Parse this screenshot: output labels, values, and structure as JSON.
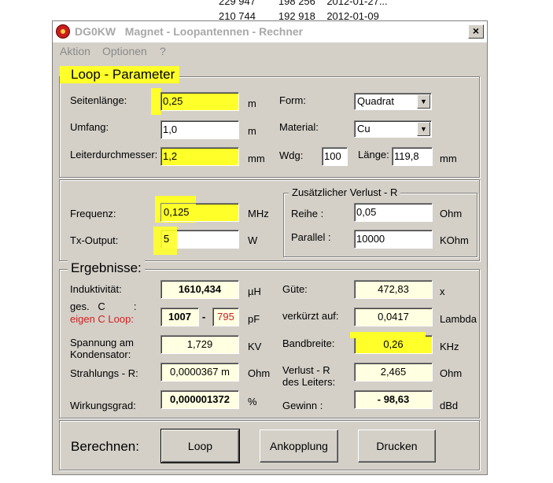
{
  "background": {
    "row1": "229 947        198 256    2012-01-27...",
    "row2": "210 744        192 918    2012-01-09"
  },
  "window": {
    "title": "DG0KW   Magnet - Loopantennen - Rechner",
    "close_label": "×"
  },
  "menu": [
    "Aktion",
    "Optionen",
    "?"
  ],
  "loop_parameter": {
    "legend": "Loop - Parameter",
    "seitenlaenge": {
      "label": "Seitenlänge:",
      "value": "0,25",
      "unit": "m"
    },
    "umfang": {
      "label": "Umfang:",
      "value": "1,0",
      "unit": "m"
    },
    "leiterdurchmesser": {
      "label": "Leiterdurchmesser:",
      "value": "1,2",
      "unit": "mm"
    },
    "form": {
      "label": "Form:",
      "value": "Quadrat"
    },
    "material": {
      "label": "Material:",
      "value": "Cu"
    },
    "wdg": {
      "label": "Wdg:",
      "value": "100"
    },
    "laenge": {
      "label": "Länge:",
      "value": "119,8",
      "unit": "mm"
    }
  },
  "frequency": {
    "frequenz": {
      "label": "Frequenz:",
      "value": "0,125",
      "unit": "MHz"
    },
    "tx_output": {
      "label": "Tx-Output:",
      "value": "5",
      "unit": "W"
    }
  },
  "verlust": {
    "legend": "Zusätzlicher Verlust - R",
    "reihe": {
      "label": "Reihe :",
      "value": "0,05",
      "unit": "Ohm"
    },
    "parallel": {
      "label": "Parallel :",
      "value": "10000",
      "unit": "KOhm"
    }
  },
  "ergebnisse": {
    "legend": "Ergebnisse:",
    "induktivitaet": {
      "label": "Induktivität:",
      "value": "1610,434",
      "unit": "µH"
    },
    "ges_c": {
      "label": "ges.   C          :",
      "label2": "eigen C Loop:",
      "value": "1007",
      "dash": "-",
      "value2": "795",
      "unit": "pF"
    },
    "spannung": {
      "label": "Spannung am",
      "label2": "Kondensator:",
      "value": "1,729",
      "unit": "KV"
    },
    "strahlung": {
      "label": "Strahlungs - R:",
      "value": "0,0000367 m",
      "unit": "Ohm"
    },
    "wirkungsgrad": {
      "label": "Wirkungsgrad:",
      "value": "0,000001372",
      "unit": "%"
    },
    "guete": {
      "label": "Güte:",
      "value": "472,83",
      "unit": "x"
    },
    "verkuerzt": {
      "label": "verkürzt auf:",
      "value": "0,0417",
      "unit": "Lambda"
    },
    "bandbreite": {
      "label": "Bandbreite:",
      "value": "0,26",
      "unit": "KHz"
    },
    "verlust_r": {
      "label": "Verlust - R",
      "label2": "des Leiters:",
      "value": "2,465",
      "unit": "Ohm"
    },
    "gewinn": {
      "label": "Gewinn :",
      "value": "- 98,63",
      "unit": "dBd"
    }
  },
  "actions": {
    "label": "Berechnen:",
    "loop_button": "Loop",
    "ankopplung_button": "Ankopplung",
    "drucken_button": "Drucken"
  },
  "colors": {
    "highlight": "#ffff29",
    "window_bg": "#d4d0c8",
    "output_bg": "#ffffe1",
    "red_text": "#d02020"
  }
}
